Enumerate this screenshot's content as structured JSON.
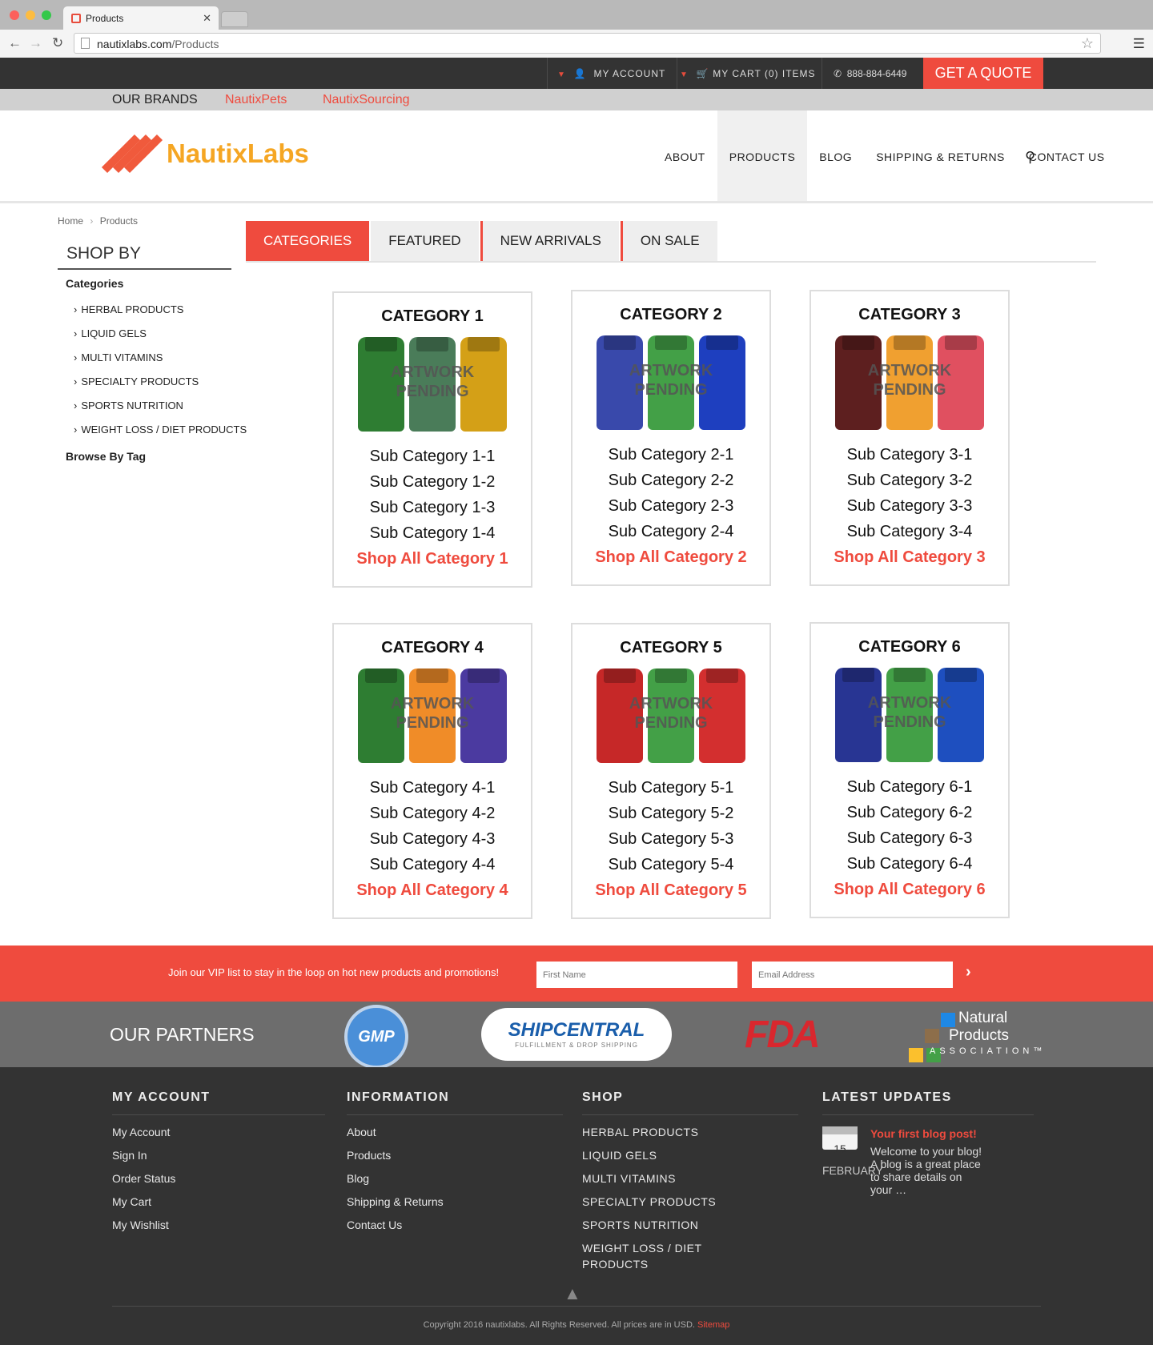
{
  "browser": {
    "tab_title": "Products",
    "url_host": "nautixlabs.com",
    "url_path": "/Products"
  },
  "topbar": {
    "account": "MY ACCOUNT",
    "cart": "MY CART (0) ITEMS",
    "phone": "888-884-6449",
    "quote": "GET A QUOTE"
  },
  "brands": {
    "label": "OUR BRANDS",
    "items": [
      "NautixPets",
      "NautixSourcing"
    ]
  },
  "header": {
    "logo_text": "NautixLabs",
    "nav": [
      "ABOUT",
      "PRODUCTS",
      "BLOG",
      "SHIPPING & RETURNS",
      "CONTACT US"
    ]
  },
  "breadcrumb": {
    "home": "Home",
    "sep": "›",
    "current": "Products"
  },
  "sidebar": {
    "title": "SHOP BY",
    "categories_label": "Categories",
    "items": [
      "HERBAL PRODUCTS",
      "LIQUID GELS",
      "MULTI VITAMINS",
      "SPECIALTY PRODUCTS",
      "SPORTS NUTRITION",
      "WEIGHT LOSS / DIET PRODUCTS"
    ],
    "tag_label": "Browse By Tag"
  },
  "tabs": [
    "CATEGORIES",
    "FEATURED",
    "NEW ARRIVALS",
    "ON SALE"
  ],
  "pending_label": [
    "ARTWORK",
    "PENDING"
  ],
  "cards": [
    {
      "title": "CATEGORY 1",
      "subs": [
        "Sub Category 1-1",
        "Sub Category 1-2",
        "Sub Category 1-3",
        "Sub Category 1-4"
      ],
      "shop_all": "Shop All Category 1",
      "colors": [
        "#2e7d32",
        "#4a7c59",
        "#d4a017"
      ]
    },
    {
      "title": "CATEGORY 2",
      "subs": [
        "Sub Category 2-1",
        "Sub Category 2-2",
        "Sub Category 2-3",
        "Sub Category 2-4"
      ],
      "shop_all": "Shop All Category 2",
      "colors": [
        "#3949ab",
        "#43a047",
        "#1e3fbf"
      ]
    },
    {
      "title": "CATEGORY 3",
      "subs": [
        "Sub Category 3-1",
        "Sub Category 3-2",
        "Sub Category 3-3",
        "Sub Category 3-4"
      ],
      "shop_all": "Shop All Category 3",
      "colors": [
        "#5d1f1f",
        "#f0a030",
        "#e05060"
      ]
    },
    {
      "title": "CATEGORY 4",
      "subs": [
        "Sub Category 4-1",
        "Sub Category 4-2",
        "Sub Category 4-3",
        "Sub Category 4-4"
      ],
      "shop_all": "Shop All Category 4",
      "colors": [
        "#2e7d32",
        "#f08c28",
        "#4b3aa0"
      ]
    },
    {
      "title": "CATEGORY 5",
      "subs": [
        "Sub Category 5-1",
        "Sub Category 5-2",
        "Sub Category 5-3",
        "Sub Category 5-4"
      ],
      "shop_all": "Shop All Category 5",
      "colors": [
        "#c62828",
        "#43a047",
        "#d32f2f"
      ]
    },
    {
      "title": "CATEGORY 6",
      "subs": [
        "Sub Category 6-1",
        "Sub Category 6-2",
        "Sub Category 6-3",
        "Sub Category 6-4"
      ],
      "shop_all": "Shop All Category 6",
      "colors": [
        "#283593",
        "#43a047",
        "#1e4fbf"
      ]
    }
  ],
  "vip": {
    "text": "Join our VIP list to stay in the loop on hot new products and promotions!",
    "first_name_placeholder": "First Name",
    "email_placeholder": "Email Address",
    "submit": "›"
  },
  "partners": {
    "title": "OUR PARTNERS",
    "gmp": "GMP",
    "shipcentral": "SHIPCENTRAL",
    "shipcentral_tag": "FULFILLMENT & DROP SHIPPING",
    "fda": "FDA",
    "npa_1": "Natural",
    "npa_2": "Products",
    "npa_3": "ASSOCIATION™"
  },
  "footer": {
    "account_title": "MY ACCOUNT",
    "account_links": [
      "My Account",
      "Sign In",
      "Order Status",
      "My Cart",
      "My Wishlist"
    ],
    "info_title": "INFORMATION",
    "info_links": [
      "About",
      "Products",
      "Blog",
      "Shipping & Returns",
      "Contact Us"
    ],
    "shop_title": "SHOP",
    "shop_links": [
      "HERBAL PRODUCTS",
      "LIQUID GELS",
      "MULTI VITAMINS",
      "SPECIALTY PRODUCTS",
      "SPORTS NUTRITION",
      "WEIGHT LOSS / DIET",
      "PRODUCTS"
    ],
    "updates_title": "LATEST UPDATES",
    "blog_day": "15",
    "blog_month": "FEBRUARY",
    "blog_title": "Your first blog post!",
    "blog_excerpt": "Welcome to your blog! A blog is a great place to share details on your …",
    "copyright": "Copyright 2016 nautixlabs. All Rights Reserved. All prices are in USD.",
    "sitemap": "Sitemap"
  },
  "colors": {
    "accent": "#ef4b3e",
    "dark": "#333333",
    "logo": "#f5a623"
  }
}
